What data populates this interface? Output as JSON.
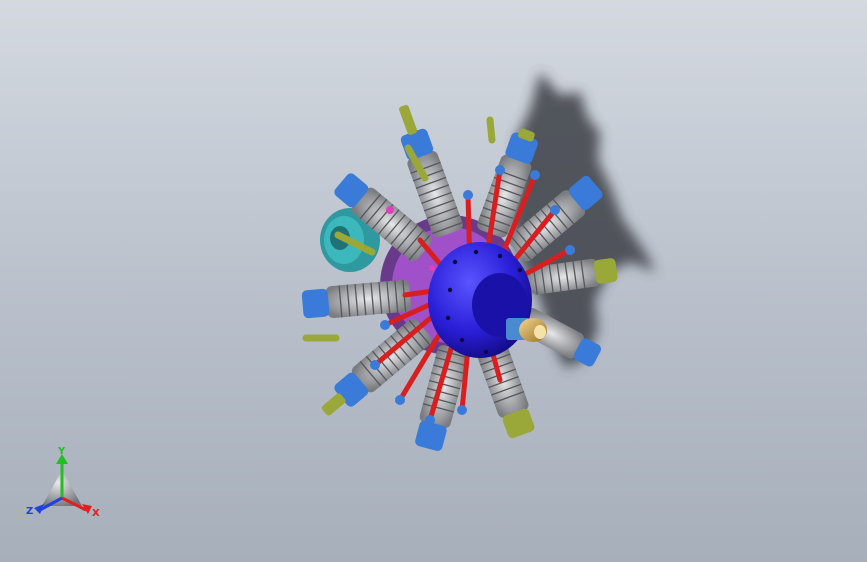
{
  "viewport": {
    "background_top": "#d4d9e0",
    "background_bottom": "#a7afbb"
  },
  "model": {
    "hub_color": "#2a1fd8",
    "pushrod_color": "#d81e1e",
    "rocker_cover_color": "#3a7ad8",
    "intake_pipe_color": "#9aa83a",
    "crankcase_color": "#a050c8",
    "accessory_color": "#2e9aa0",
    "prop_nut_color": "#c8a040",
    "shadow_color": "#3c3f46"
  },
  "triad": {
    "x_label": "X",
    "y_label": "Y",
    "z_label": "Z",
    "x_color": "#e02020",
    "y_color": "#20c020",
    "z_color": "#2040e0"
  }
}
